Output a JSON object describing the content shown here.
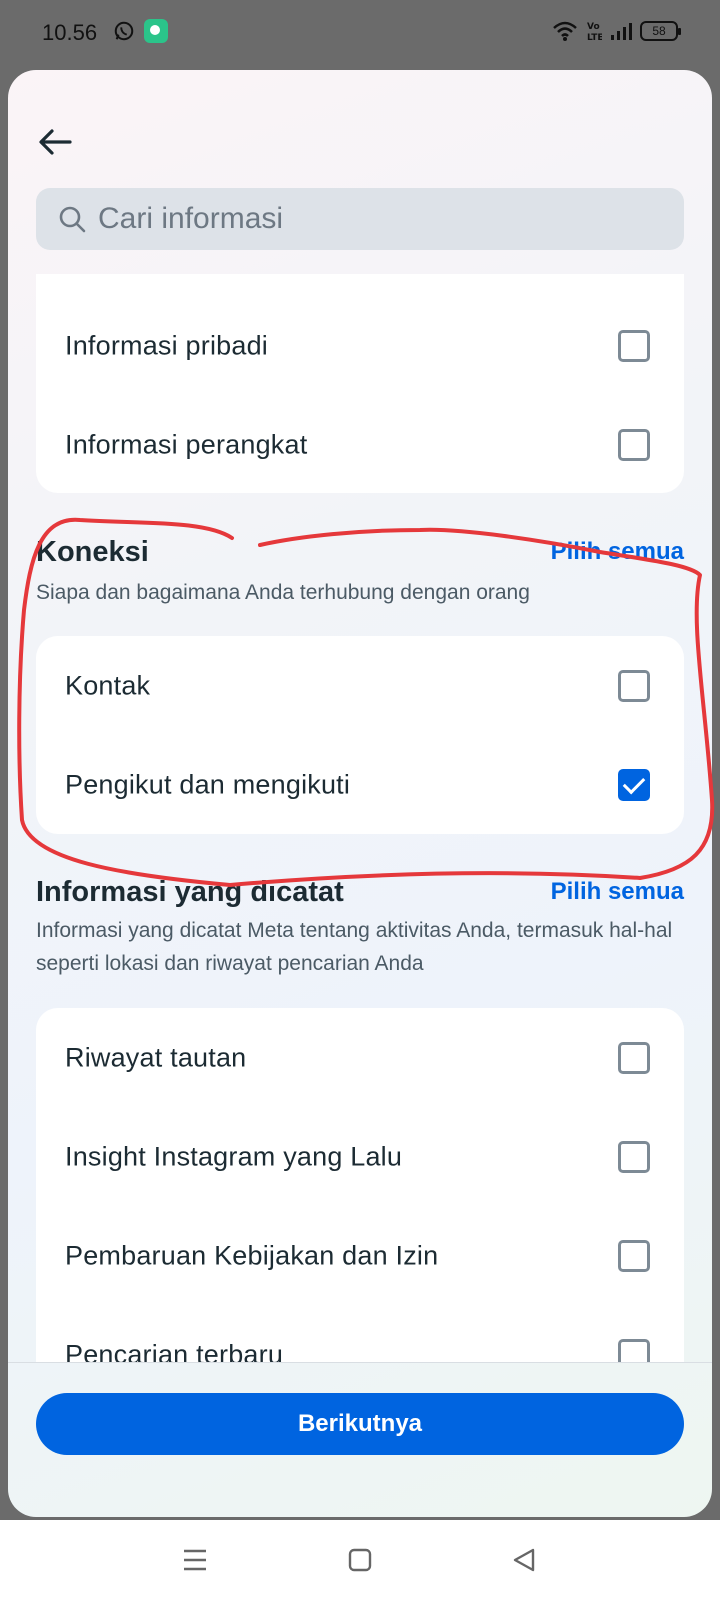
{
  "status_bar": {
    "time": "10.56",
    "battery": "58",
    "icons": [
      "whatsapp-icon",
      "app-notification-icon",
      "wifi-icon",
      "volte-icon",
      "signal-icon",
      "battery-icon"
    ]
  },
  "header": {
    "back_icon": "arrow-left-icon",
    "search_placeholder": "Cari informasi",
    "search_icon": "search-icon"
  },
  "top_card": {
    "items": [
      {
        "label": "Informasi pribadi",
        "checked": false
      },
      {
        "label": "Informasi perangkat",
        "checked": false
      }
    ]
  },
  "koneksi": {
    "title": "Koneksi",
    "select_all": "Pilih semua",
    "description": "Siapa dan bagaimana Anda terhubung dengan orang",
    "items": [
      {
        "label": "Kontak",
        "checked": false
      },
      {
        "label": "Pengikut dan mengikuti",
        "checked": true
      }
    ]
  },
  "logged": {
    "title": "Informasi yang dicatat",
    "select_all": "Pilih semua",
    "description": "Informasi yang dicatat Meta tentang aktivitas Anda, termasuk hal-hal seperti lokasi dan riwayat pencarian Anda",
    "items": [
      {
        "label": "Riwayat tautan",
        "checked": false
      },
      {
        "label": "Insight Instagram yang Lalu",
        "checked": false
      },
      {
        "label": "Pembaruan Kebijakan dan Izin",
        "checked": false
      },
      {
        "label": "Pencarian terbaru",
        "checked": false
      }
    ]
  },
  "footer": {
    "next_label": "Berikutnya"
  },
  "colors": {
    "accent": "#0064e0",
    "annotation": "#e5383b"
  }
}
